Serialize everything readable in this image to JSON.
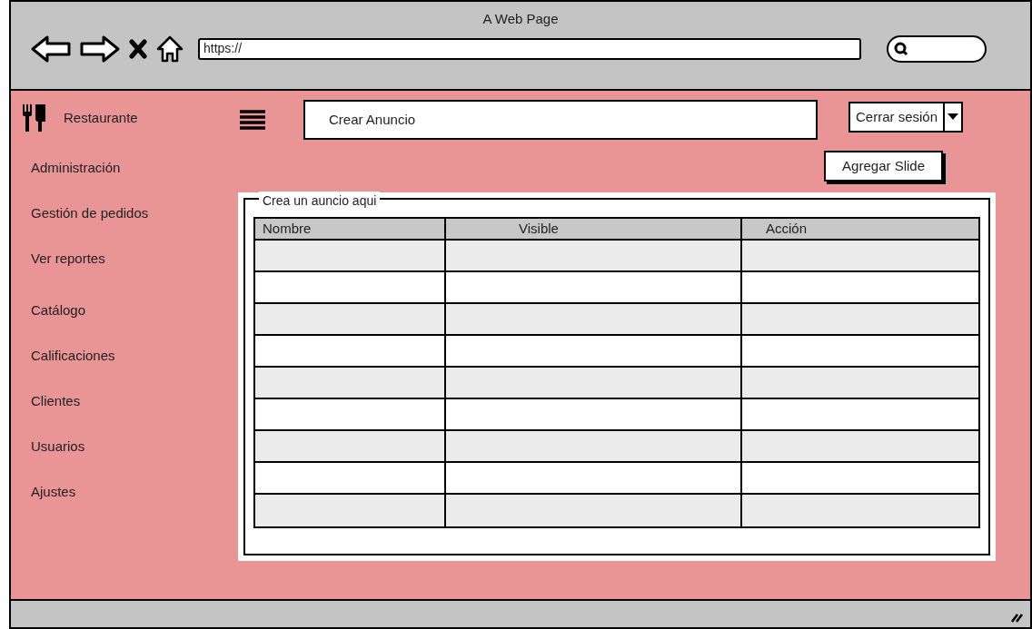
{
  "browser": {
    "title": "A Web Page",
    "url": "https://"
  },
  "brand": {
    "name": "Restaurante"
  },
  "sidebar": {
    "items": [
      {
        "label": "Administración"
      },
      {
        "label": "Gestión de pedidos"
      },
      {
        "label": "Ver reportes"
      },
      {
        "label": "Catálogo"
      },
      {
        "label": "Calificaciones"
      },
      {
        "label": "Clientes"
      },
      {
        "label": "Usuarios"
      },
      {
        "label": "Ajustes"
      }
    ]
  },
  "header_field": {
    "value": "Crear Anuncio"
  },
  "session_menu": {
    "label": "Cerrar sesión"
  },
  "add_button": {
    "label": "Agregar Slide"
  },
  "panel": {
    "title": "Crea un auncio aqui",
    "table": {
      "columns": [
        "Nombre",
        "Visible",
        "Acción"
      ]
    }
  }
}
